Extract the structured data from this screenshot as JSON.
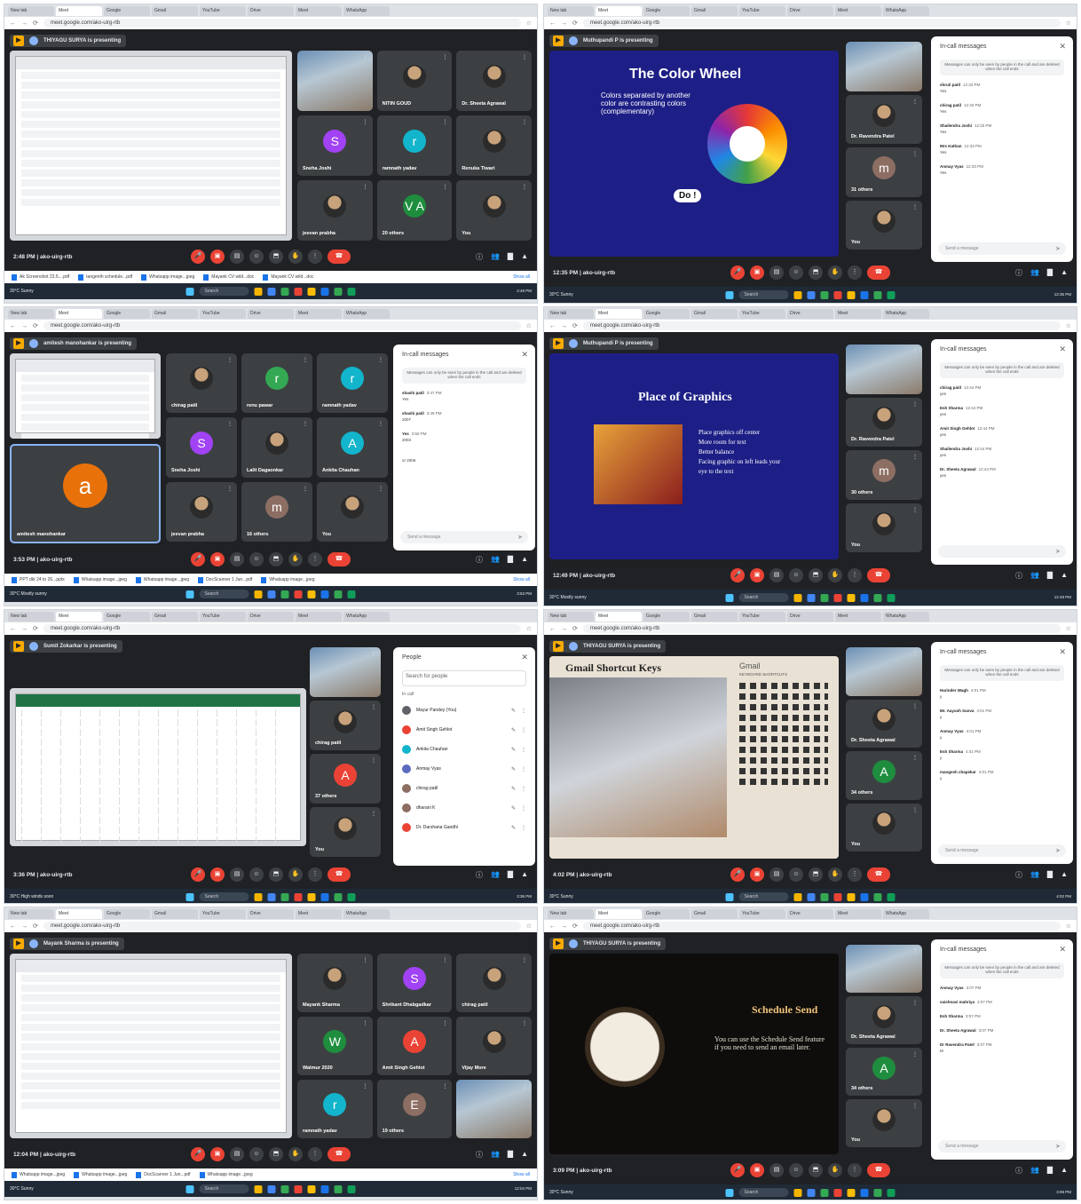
{
  "browser": {
    "url": "meet.google.com/ako-uirg-rtb",
    "tabs": [
      "New tab",
      "Meet",
      "Google",
      "Gmail",
      "YouTube",
      "Drive",
      "Meet",
      "WhatsApp"
    ]
  },
  "panels": [
    {
      "presenter": "THIYAGU SURYA is presenting",
      "time": "2:48 PM",
      "code": "ako-uirg-rtb",
      "tiles": [
        {
          "name": "",
          "kind": "video"
        },
        {
          "name": "NITIN GOUD",
          "kind": "photo"
        },
        {
          "name": "Dr. Sheeta Agrawal",
          "kind": "photo"
        },
        {
          "name": "Sneha Joshi",
          "kind": "letter",
          "letter": "S",
          "color": "#a142f4"
        },
        {
          "name": "ramnath yadav",
          "kind": "letter",
          "letter": "r",
          "color": "#12b5cb"
        },
        {
          "name": "Renuka Tiwari",
          "kind": "photo"
        },
        {
          "name": "jeevan prabha",
          "kind": "photo"
        },
        {
          "name": "20 others",
          "kind": "letter",
          "letter": "V A",
          "color": "#1e8e3e"
        },
        {
          "name": "You",
          "kind": "photo"
        }
      ],
      "downloads": [
        "Ak Screenshot 23.5....pdf",
        "tangenth schedule...pdf",
        "Whatsapp image...jpeg",
        "Mayank CV wild...doc",
        "Mayank CV wild...doc"
      ],
      "show_all": "Show all",
      "weather": "30°C Sunny",
      "clock": "2:48 PM"
    },
    {
      "presenter": "Muthupandi P is presenting",
      "time": "12:35 PM",
      "code": "ako-uirg-rtb",
      "slide_title": "The Color Wheel",
      "slide_bullet": "Colors separated by another color are contrasting colors (complementary)",
      "slide_badge": "Do !",
      "side_tiles": [
        {
          "name": "",
          "kind": "video"
        },
        {
          "name": "Dr. Ravendra Patel",
          "kind": "photo"
        },
        {
          "name": "31 others",
          "kind": "letter",
          "letter": "m",
          "color": "#8d6e63"
        },
        {
          "name": "You",
          "kind": "photo"
        }
      ],
      "chat_title": "In-call messages",
      "chat_note": "Messages can only be seen by people in the call and are deleted when the call ends",
      "chat_input": "Send a message",
      "messages": [
        {
          "from": "shruti patil",
          "time": "12:33 PM",
          "text": "Yes"
        },
        {
          "from": "chirag patil",
          "time": "12:33 PM",
          "text": "Yes"
        },
        {
          "from": "Shailendra Joshi",
          "time": "12:33 PM",
          "text": "Yes"
        },
        {
          "from": "Mrs Kathan",
          "time": "12:33 PM",
          "text": "Yes"
        },
        {
          "from": "Anmay Vyas",
          "time": "12:33 PM",
          "text": "Yes"
        }
      ],
      "weather": "30°C Sunny",
      "clock": "12:35 PM"
    },
    {
      "presenter": "amitesh manohankar is presenting",
      "time": "3:53 PM",
      "code": "ako-uirg-rtb",
      "tiles": [
        {
          "name": "chirag patil",
          "kind": "photo"
        },
        {
          "name": "renu pawar",
          "kind": "letter",
          "letter": "r",
          "color": "#34a853"
        },
        {
          "name": "ramnath yadav",
          "kind": "letter",
          "letter": "r",
          "color": "#12b5cb"
        },
        {
          "name": "Sneha Joshi",
          "kind": "letter",
          "letter": "S",
          "color": "#a142f4"
        },
        {
          "name": "Lalit Dagaonkar",
          "kind": "photo"
        },
        {
          "name": "Ankita Chauhan",
          "kind": "letter",
          "letter": "A",
          "color": "#12b5cb"
        },
        {
          "name": "jeevan prabha",
          "kind": "photo"
        },
        {
          "name": "16 others",
          "kind": "letter",
          "letter": "m",
          "color": "#8d6e63"
        },
        {
          "name": "You",
          "kind": "photo"
        }
      ],
      "self_tile": {
        "name": "amitesh manohankar",
        "letter": "a",
        "color": "#e8710a"
      },
      "chat_title": "In-call messages",
      "chat_note": "Messages can only be seen by people in the call and are deleted when the call ends",
      "chat_input": "Send a message",
      "messages": [
        {
          "from": "shashi patil",
          "time": "3:47 PM",
          "text": "Yes"
        },
        {
          "from": "shashi patil",
          "time": "3:49 PM",
          "text": "2007"
        },
        {
          "from": "Yes",
          "time": "3:50 PM",
          "text": "2003"
        },
        {
          "from": "",
          "time": "",
          "text": "or 2006"
        }
      ],
      "downloads": [
        "PPT dkt 24 to 26...pptx",
        "Whatsapp image...jpeg",
        "Whatsapp image...jpeg",
        "DocScanner 1 Jun...pdf",
        "Whatsapp image...jpeg"
      ],
      "show_all": "Show all",
      "weather": "30°C Mostly sunny",
      "clock": "3:53 PM"
    },
    {
      "presenter": "Muthupandi P is presenting",
      "time": "12:49 PM",
      "code": "ako-uirg-rtb",
      "slide_title": "Place of Graphics",
      "slide_bullets": [
        "Place graphics off center",
        "More room for text",
        "Better balance",
        "Facing graphic on left leads your eye to the text"
      ],
      "side_tiles": [
        {
          "name": "",
          "kind": "video"
        },
        {
          "name": "Dr. Ravendra Patel",
          "kind": "photo"
        },
        {
          "name": "30 others",
          "kind": "letter",
          "letter": "m",
          "color": "#8d6e63"
        },
        {
          "name": "You",
          "kind": "photo"
        }
      ],
      "chat_title": "In-call messages",
      "chat_note": "Messages can only be seen by people in the call and are deleted when the call ends",
      "chat_input": "",
      "messages": [
        {
          "from": "chirag patil",
          "time": "12:44 PM",
          "text": "yes"
        },
        {
          "from": "Esh Sharma",
          "time": "12:44 PM",
          "text": "yes"
        },
        {
          "from": "Amit Singh Gehlot",
          "time": "12:44 PM",
          "text": "yes"
        },
        {
          "from": "Shailendra Joshi",
          "time": "12:44 PM",
          "text": "yes"
        },
        {
          "from": "Dr. Sheeta Agrawal",
          "time": "12:44 PM",
          "text": "yes"
        }
      ],
      "weather": "30°C Mostly sunny",
      "clock": "12:49 PM"
    },
    {
      "presenter": "Sumit Zokarkar is presenting",
      "time": "3:36 PM",
      "code": "ako-uirg-rtb",
      "side_tiles": [
        {
          "name": "",
          "kind": "video"
        },
        {
          "name": "chirag patil",
          "kind": "photo"
        },
        {
          "name": "37 others",
          "kind": "letter",
          "letter": "A",
          "color": "#ea4335"
        },
        {
          "name": "You",
          "kind": "photo"
        }
      ],
      "people_title": "People",
      "people_search": "Search for people",
      "people_section": "In call",
      "people": [
        {
          "name": "Mayur Pandey (You)",
          "color": "#5f6368"
        },
        {
          "name": "Amit Singh Gehlot",
          "color": "#ea4335"
        },
        {
          "name": "Ankita Chauhan",
          "color": "#12b5cb"
        },
        {
          "name": "Anmay Vyas",
          "color": "#5c6bc0"
        },
        {
          "name": "chirag patil",
          "color": "#8d6e63"
        },
        {
          "name": "dharani K",
          "color": "#8d6e63"
        },
        {
          "name": "Dr. Darshana Gandhi",
          "color": "#ea4335"
        }
      ],
      "weather": "30°C High winds soon",
      "clock": "3:36 PM"
    },
    {
      "presenter": "THIYAGU SURYA is presenting",
      "time": "4:02 PM",
      "code": "ako-uirg-rtb",
      "slide_title": "Gmail Shortcut Keys",
      "slide_subtitle": "Gmail",
      "slide_caption": "KEYBOARD SHORTCUTS",
      "side_tiles": [
        {
          "name": "",
          "kind": "video"
        },
        {
          "name": "Dr. Sheeta Agrawal",
          "kind": "photo"
        },
        {
          "name": "34 others",
          "kind": "letter",
          "letter": "A",
          "color": "#1e8e3e"
        },
        {
          "name": "You",
          "kind": "photo"
        }
      ],
      "chat_title": "In-call messages",
      "chat_note": "Messages can only be seen by people in the call and are deleted when the call ends",
      "chat_input": "Send a message",
      "messages": [
        {
          "from": "Harinder Wagh",
          "time": "4:01 PM",
          "text": "y"
        },
        {
          "from": "Mr. Aayush Sanva",
          "time": "4:01 PM",
          "text": "y"
        },
        {
          "from": "Anmay Vyas",
          "time": "4:01 PM",
          "text": "y"
        },
        {
          "from": "Esh Sharma",
          "time": "4:01 PM",
          "text": "y"
        },
        {
          "from": "mangesh chapekar",
          "time": "4:01 PM",
          "text": "y"
        }
      ],
      "weather": "30°C Sunny",
      "clock": "4:02 PM"
    },
    {
      "presenter": "Mayank Sharma is presenting",
      "time": "12:04 PM",
      "code": "ako-uirg-rtb",
      "tiles": [
        {
          "name": "Mayank Sharma",
          "kind": "photo"
        },
        {
          "name": "Shrikant Dhabgadkar",
          "kind": "letter",
          "letter": "S",
          "color": "#a142f4"
        },
        {
          "name": "chirag patil",
          "kind": "photo"
        },
        {
          "name": "Walmur 2020",
          "kind": "letter",
          "letter": "W",
          "color": "#1e8e3e"
        },
        {
          "name": "Amit Singh Gehlot",
          "kind": "letter",
          "letter": "A",
          "color": "#ea4335"
        },
        {
          "name": "Vijay More",
          "kind": "photo"
        },
        {
          "name": "ramnath yadav",
          "kind": "letter",
          "letter": "r",
          "color": "#12b5cb"
        },
        {
          "name": "19 others",
          "kind": "letter",
          "letter": "E",
          "color": "#8d6e63"
        },
        {
          "name": "",
          "kind": "video"
        }
      ],
      "downloads": [
        "Whatsapp image...jpeg",
        "Whatsapp image...jpeg",
        "DocScanner 1 Jun...pdf",
        "Whatsapp image...jpeg"
      ],
      "show_all": "Show all",
      "weather": "30°C Sunny",
      "clock": "12:04 PM"
    },
    {
      "presenter": "THIYAGU SURYA is presenting",
      "time": "3:09 PM",
      "code": "ako-uirg-rtb",
      "slide_title": "Schedule Send",
      "slide_text": "You can use the Schedule Send feature if you need to send an email later.",
      "side_tiles": [
        {
          "name": "",
          "kind": "video"
        },
        {
          "name": "Dr. Sheeta Agrawal",
          "kind": "photo"
        },
        {
          "name": "34 others",
          "kind": "letter",
          "letter": "A",
          "color": "#1e8e3e"
        },
        {
          "name": "You",
          "kind": "photo"
        }
      ],
      "chat_title": "In-call messages",
      "chat_note": "Messages can only be seen by people in the call and are deleted when the call ends",
      "chat_input": "Send a message",
      "messages": [
        {
          "from": "Anmay Vyas",
          "time": "3:07 PM",
          "text": ""
        },
        {
          "from": "vaishnavi mahriya",
          "time": "3:07 PM",
          "text": ""
        },
        {
          "from": "Esh Sharma",
          "time": "3:07 PM",
          "text": ""
        },
        {
          "from": "Dr. Sheeta Agrawal",
          "time": "3:07 PM",
          "text": ""
        },
        {
          "from": "Dr Ravendra Patel",
          "time": "3:07 PM",
          "text": "M"
        }
      ],
      "weather": "30°C Sunny",
      "clock": "3:09 PM"
    }
  ],
  "taskbar": {
    "search": "Search"
  },
  "colors": {
    "meet_bg": "#202124",
    "tile_bg": "#3c4043",
    "end_call": "#ea4335",
    "accent": "#8ab4f8"
  }
}
